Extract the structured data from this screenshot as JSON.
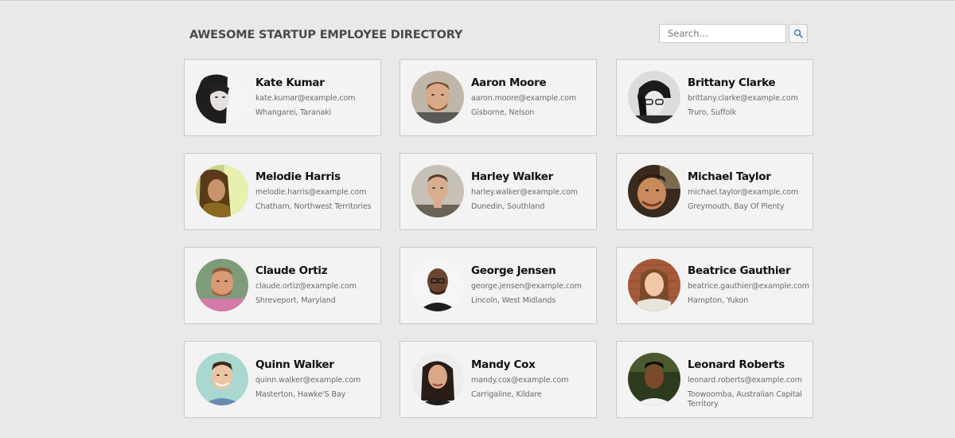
{
  "header": {
    "title": "AWESOME STARTUP EMPLOYEE DIRECTORY",
    "search_placeholder": "Search...",
    "search_icon": "search-icon"
  },
  "employees": [
    {
      "name": "Kate Kumar",
      "email": "kate.kumar@example.com",
      "location": "Whangarei, Taranaki"
    },
    {
      "name": "Aaron Moore",
      "email": "aaron.moore@example.com",
      "location": "Gisborne, Nelson"
    },
    {
      "name": "Brittany Clarke",
      "email": "brittany.clarke@example.com",
      "location": "Truro, Suffolk"
    },
    {
      "name": "Melodie Harris",
      "email": "melodie.harris@example.com",
      "location": "Chatham, Northwest Territories"
    },
    {
      "name": "Harley Walker",
      "email": "harley.walker@example.com",
      "location": "Dunedin, Southland"
    },
    {
      "name": "Michael Taylor",
      "email": "michael.taylor@example.com",
      "location": "Greymouth, Bay Of Plenty"
    },
    {
      "name": "Claude Ortiz",
      "email": "claude.ortiz@example.com",
      "location": "Shreveport, Maryland"
    },
    {
      "name": "George Jensen",
      "email": "george.jensen@example.com",
      "location": "Lincoln, West Midlands"
    },
    {
      "name": "Beatrice Gauthier",
      "email": "beatrice.gauthier@example.com",
      "location": "Hampton, Yukon"
    },
    {
      "name": "Quinn Walker",
      "email": "quinn.walker@example.com",
      "location": "Masterton, Hawke'S Bay"
    },
    {
      "name": "Mandy Cox",
      "email": "mandy.cox@example.com",
      "location": "Carrigaline, Kildare"
    },
    {
      "name": "Leonard Roberts",
      "email": "leonard.roberts@example.com",
      "location": "Toowoomba, Australian Capital Territory"
    }
  ]
}
